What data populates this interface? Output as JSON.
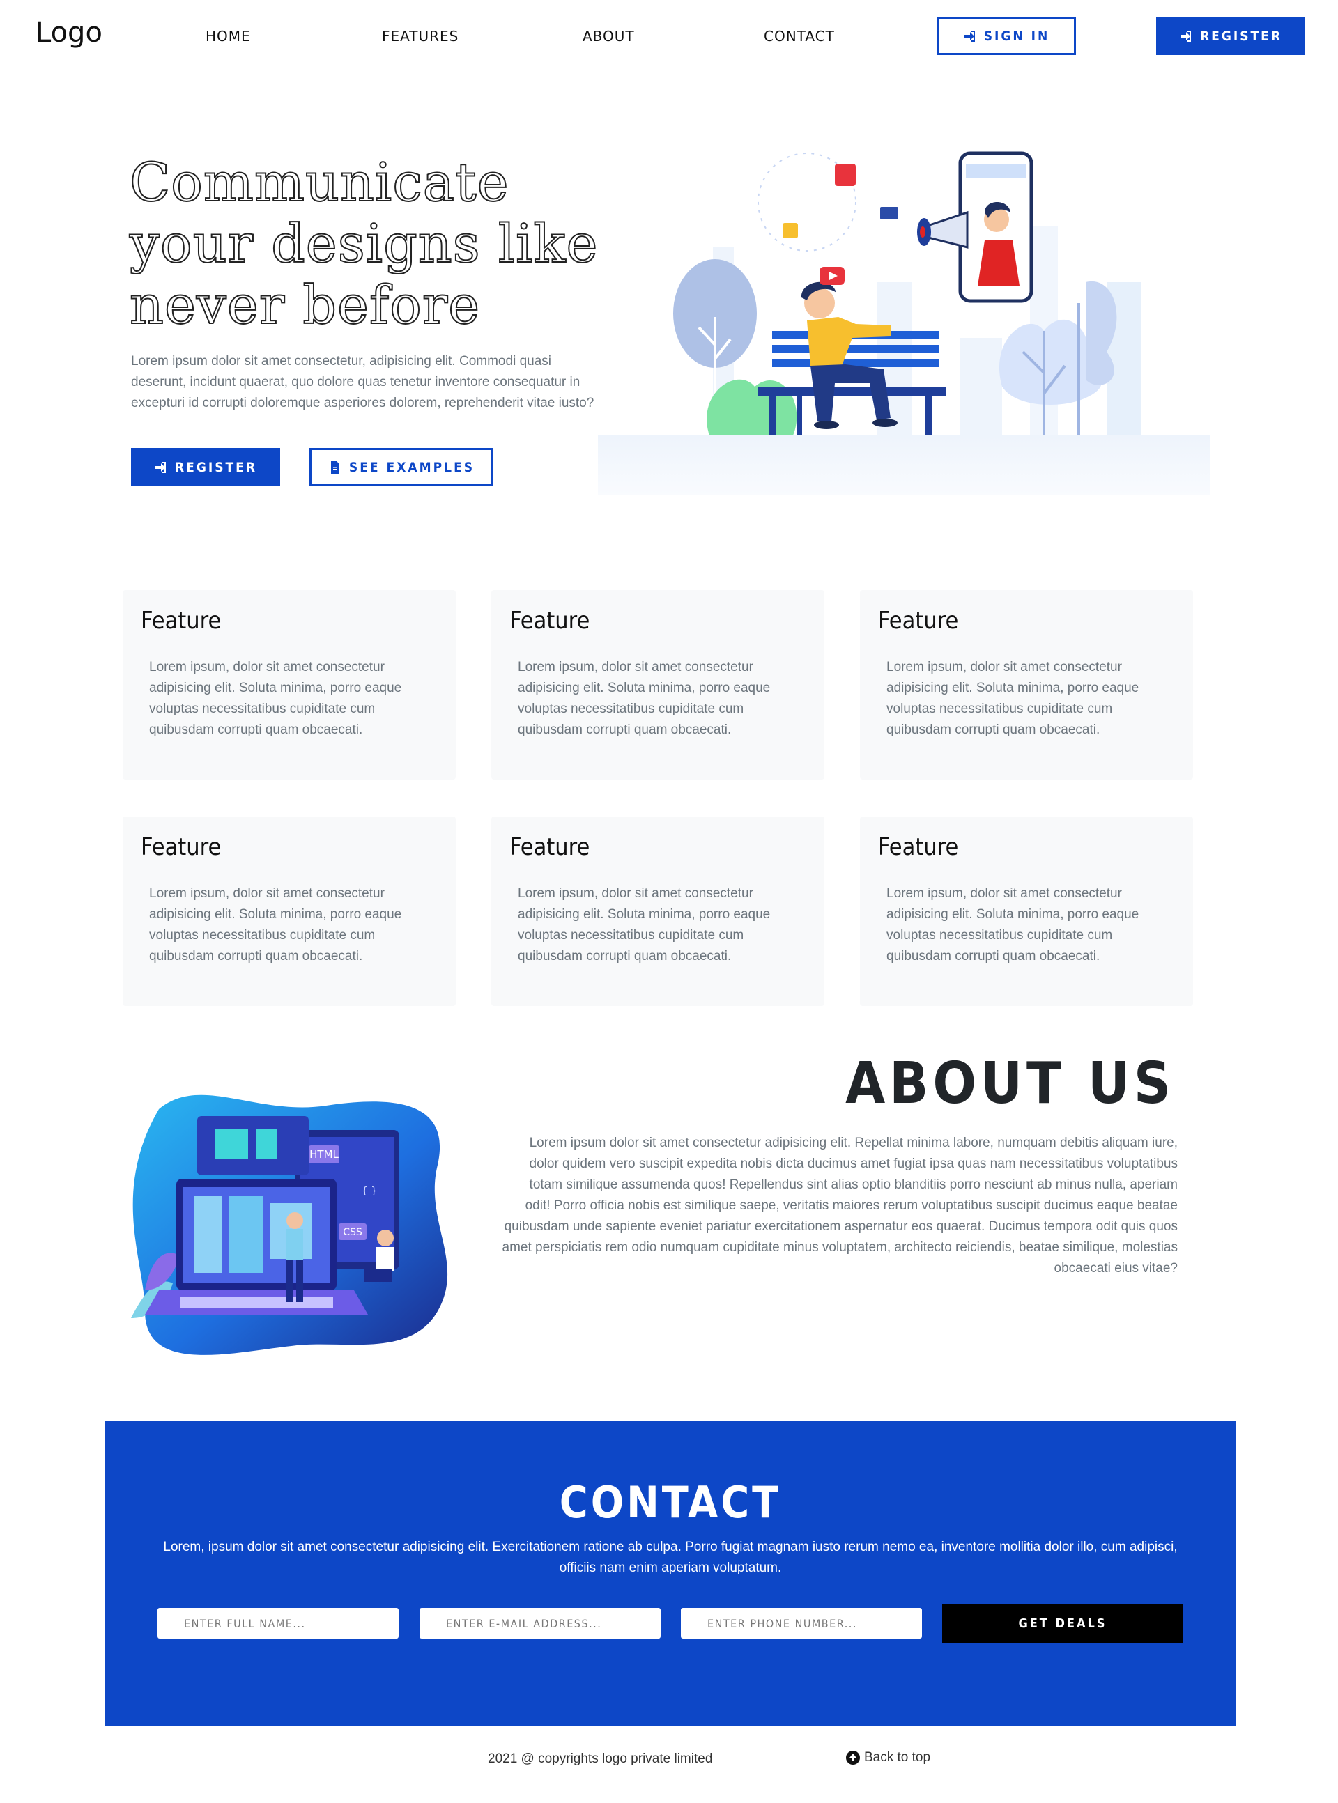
{
  "nav": {
    "logo": "Logo",
    "links": [
      "HOME",
      "FEATURES",
      "ABOUT",
      "CONTACT"
    ],
    "sign_in": "SIGN IN",
    "register": "REGISTER"
  },
  "hero": {
    "title": "Communicate your designs like never before",
    "text": "Lorem ipsum dolor sit amet consectetur, adipisicing elit. Commodi quasi deserunt, incidunt quaerat, quo dolore quas tenetur inventore consequatur in excepturi id corrupti doloremque asperiores dolorem, reprehenderit vitae iusto?",
    "register": "REGISTER",
    "examples": "SEE EXAMPLES"
  },
  "features": [
    {
      "title": "Feature",
      "text": "Lorem ipsum, dolor sit amet consectetur adipisicing elit. Soluta minima, porro eaque voluptas necessitatibus cupiditate cum quibusdam corrupti quam obcaecati."
    },
    {
      "title": "Feature",
      "text": "Lorem ipsum, dolor sit amet consectetur adipisicing elit. Soluta minima, porro eaque voluptas necessitatibus cupiditate cum quibusdam corrupti quam obcaecati."
    },
    {
      "title": "Feature",
      "text": "Lorem ipsum, dolor sit amet consectetur adipisicing elit. Soluta minima, porro eaque voluptas necessitatibus cupiditate cum quibusdam corrupti quam obcaecati."
    },
    {
      "title": "Feature",
      "text": "Lorem ipsum, dolor sit amet consectetur adipisicing elit. Soluta minima, porro eaque voluptas necessitatibus cupiditate cum quibusdam corrupti quam obcaecati."
    },
    {
      "title": "Feature",
      "text": "Lorem ipsum, dolor sit amet consectetur adipisicing elit. Soluta minima, porro eaque voluptas necessitatibus cupiditate cum quibusdam corrupti quam obcaecati."
    },
    {
      "title": "Feature",
      "text": "Lorem ipsum, dolor sit amet consectetur adipisicing elit. Soluta minima, porro eaque voluptas necessitatibus cupiditate cum quibusdam corrupti quam obcaecati."
    }
  ],
  "about": {
    "title": "ABOUT US",
    "text": "Lorem ipsum dolor sit amet consectetur adipisicing elit. Repellat minima labore, numquam debitis aliquam iure, dolor quidem vero suscipit expedita nobis dicta ducimus amet fugiat ipsa quas nam necessitatibus voluptatibus totam similique assumenda quos! Repellendus sint alias optio blanditiis porro nesciunt ab minus nulla, aperiam odit! Porro officia nobis est similique saepe, veritatis maiores rerum voluptatibus suscipit ducimus eaque beatae quibusdam unde sapiente eveniet pariatur exercitationem aspernatur eos quaerat. Ducimus tempora odit quis quos amet perspiciatis rem odio numquam cupiditate minus voluptatem, architecto reiciendis, beatae similique, molestias obcaecati eius vitae?",
    "art_labels": [
      "HTML",
      "CSS",
      "{ }"
    ]
  },
  "contact": {
    "title": "CONTACT",
    "text": "Lorem, ipsum dolor sit amet consectetur adipisicing elit. Exercitationem ratione ab culpa. Porro fugiat magnam iusto rerum nemo ea, inventore mollitia dolor illo, cum adipisci, officiis nam enim aperiam voluptatum.",
    "name_placeholder": "ENTER FULL NAME...",
    "email_placeholder": "ENTER E-MAIL ADDRESS...",
    "phone_placeholder": "ENTER PHONE NUMBER...",
    "submit": "GET DEALS"
  },
  "footer": {
    "copyright": "2021 @ copyrights logo private limited",
    "back_to_top": "Back to top"
  },
  "colors": {
    "brand": "#0d47c7",
    "card_bg": "#f8f9fa",
    "muted_text": "#6c757d"
  }
}
